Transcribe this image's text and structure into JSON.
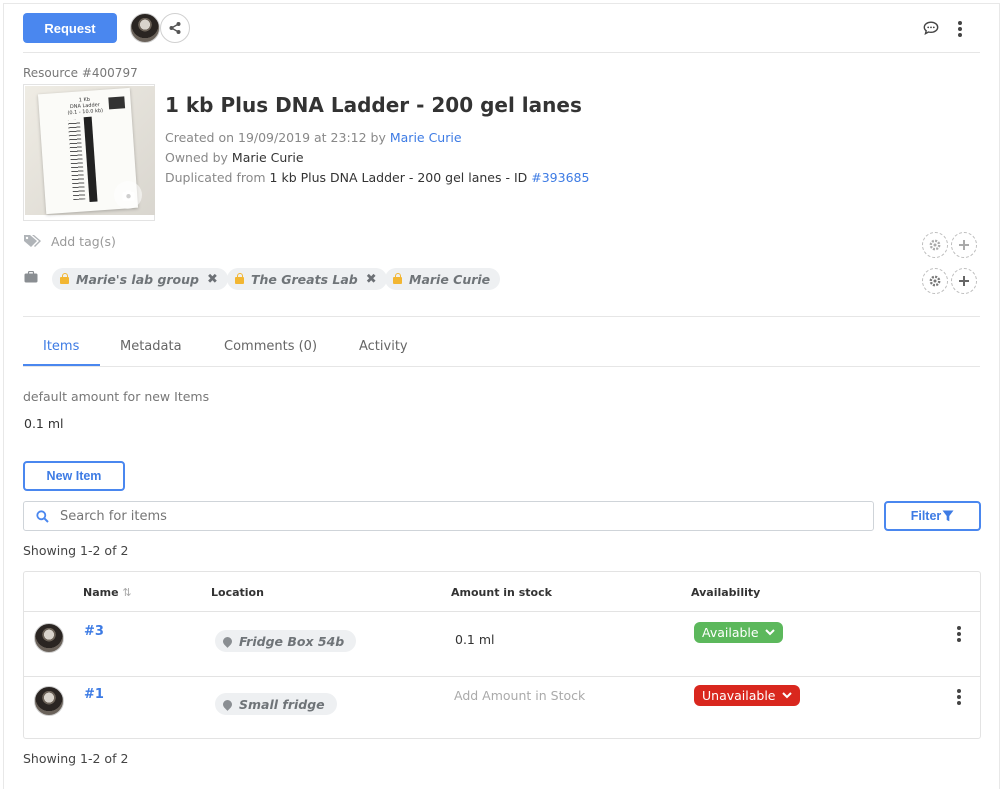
{
  "header": {
    "request_label": "Request",
    "icons": [
      "share-icon",
      "comment-icon",
      "kebab-menu-icon"
    ]
  },
  "resource": {
    "id_label": "Resource #400797",
    "title": "1 kb Plus DNA Ladder - 200 gel lanes",
    "created_prefix": "Created on 19/09/2019 at 23:12 by",
    "created_by": "Marie Curie",
    "owned_prefix": "Owned by",
    "owned_by": "Marie Curie",
    "duplicated_prefix": "Duplicated from",
    "duplicated_name": "1 kb Plus DNA Ladder - 200 gel lanes - ID",
    "duplicated_id": "#393685",
    "thumbnail_lines": [
      "1 Kb",
      "DNA Ladder",
      "(0.1 - 10.0 kb)"
    ]
  },
  "tags": {
    "placeholder": "Add tag(s)"
  },
  "groups": [
    {
      "name": "Marie's lab group",
      "removable": true
    },
    {
      "name": "The Greats Lab",
      "removable": true
    },
    {
      "name": "Marie Curie",
      "removable": false
    }
  ],
  "tabs": [
    {
      "label": "Items",
      "active": true
    },
    {
      "label": "Metadata",
      "active": false
    },
    {
      "label": "Comments (0)",
      "active": false
    },
    {
      "label": "Activity",
      "active": false
    }
  ],
  "items_panel": {
    "default_amount_label": "default amount for new Items",
    "default_amount_value": "0.1 ml",
    "new_item_label": "New Item",
    "search_placeholder": "Search for items",
    "filter_label": "Filter",
    "showing_top": "Showing 1-2 of 2",
    "showing_bottom": "Showing 1-2 of 2"
  },
  "table": {
    "columns": [
      "Name",
      "Location",
      "Amount in stock",
      "Availability"
    ],
    "rows": [
      {
        "name": "#3",
        "location": "Fridge Box 54b",
        "amount": "0.1 ml",
        "amount_is_placeholder": false,
        "availability": "Available",
        "availability_color": "#5cb85c"
      },
      {
        "name": "#1",
        "location": "Small fridge",
        "amount": "Add Amount in Stock",
        "amount_is_placeholder": true,
        "availability": "Unavailable",
        "availability_color": "#d9271e"
      }
    ]
  },
  "colors": {
    "accent": "#4a87ef",
    "link": "#3d7be4",
    "available": "#5cb85c",
    "unavailable": "#d9271e"
  }
}
